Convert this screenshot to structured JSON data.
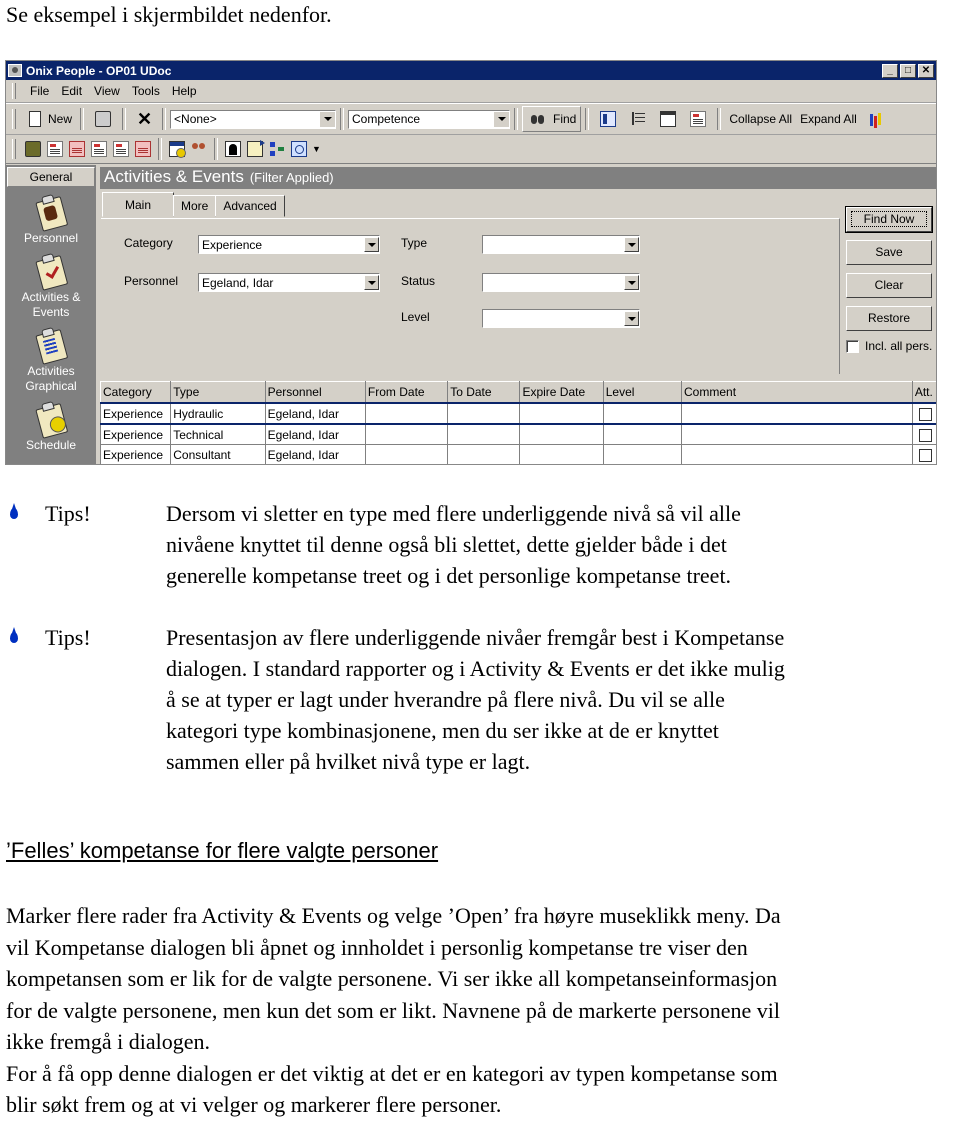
{
  "intro": "Se eksempel i skjermbildet nedenfor.",
  "window": {
    "title": "Onix People - OP01 UDoc",
    "controls": [
      "_",
      "□",
      "✕"
    ],
    "menu": [
      {
        "label": "File",
        "underline": "F"
      },
      {
        "label": "Edit",
        "underline": "E"
      },
      {
        "label": "View",
        "underline": "V"
      },
      {
        "label": "Tools",
        "underline": "T"
      },
      {
        "label": "Help",
        "underline": "H"
      }
    ],
    "toolbar": {
      "new_label": "New",
      "combo1_value": "<None>",
      "combo2_value": "Competence",
      "find_label": "Find",
      "collapse_all": "Collapse All",
      "expand_all": "Expand All"
    },
    "toolbar2_icons": [
      "folder-icon",
      "document-icon",
      "red-document-icon",
      "copy-document-icon",
      "delete-document-icon",
      "numbered-document-icon",
      "calendar-clock-icon",
      "people-icon",
      "person-silhouette-icon",
      "house-arrow-icon",
      "flow-arrow-icon",
      "circle-icon"
    ],
    "sidebar": {
      "header": "General",
      "items": [
        {
          "label": "Personnel",
          "icon": "personnel-clipboard-icon"
        },
        {
          "label": "Activities & Events",
          "icon": "activities-clipboard-icon"
        },
        {
          "label": "Activities Graphical",
          "icon": "graphical-clipboard-icon"
        },
        {
          "label": "Schedule",
          "icon": "schedule-clipboard-icon"
        }
      ]
    },
    "panel": {
      "title": "Activities & Events",
      "subtitle": "(Filter Applied)",
      "tabs": [
        "Main",
        "More",
        "Advanced"
      ],
      "active_tab": "Main",
      "fields": {
        "category": {
          "label": "Category",
          "value": "Experience"
        },
        "personnel": {
          "label": "Personnel",
          "value": "Egeland, Idar"
        },
        "type": {
          "label": "Type",
          "value": ""
        },
        "status": {
          "label": "Status",
          "value": ""
        },
        "level": {
          "label": "Level",
          "value": ""
        }
      },
      "buttons": {
        "find_now": "Find Now",
        "save": "Save",
        "clear": "Clear",
        "restore": "Restore"
      },
      "incl_all_pers": {
        "label": "Incl. all pers.",
        "checked": false
      }
    },
    "grid": {
      "columns": [
        "Category",
        "Type",
        "Personnel",
        "From Date",
        "To Date",
        "Expire Date",
        "Level",
        "Comment",
        "Att."
      ],
      "rows": [
        {
          "category": "Experience",
          "type": "Hydraulic",
          "personnel": "Egeland, Idar",
          "from": "",
          "to": "",
          "expire": "",
          "level": "",
          "comment": "",
          "att": false
        },
        {
          "category": "Experience",
          "type": "Technical",
          "personnel": "Egeland, Idar",
          "from": "",
          "to": "",
          "expire": "",
          "level": "",
          "comment": "",
          "att": false
        },
        {
          "category": "Experience",
          "type": "Consultant",
          "personnel": "Egeland, Idar",
          "from": "",
          "to": "",
          "expire": "",
          "level": "",
          "comment": "",
          "att": false
        }
      ]
    }
  },
  "tips": [
    {
      "label": "Tips!",
      "lines": [
        "Dersom vi sletter en type med flere underliggende nivå så vil alle",
        "nivåene knyttet til denne også bli slettet, dette gjelder både i det",
        "generelle kompetanse treet og i det personlige kompetanse treet."
      ]
    },
    {
      "label": "Tips!",
      "lines": [
        "Presentasjon av flere underliggende nivåer fremgår best i Kompetanse",
        "dialogen. I standard rapporter og i Activity & Events er det ikke mulig",
        "å se at typer  er lagt under hverandre på flere nivå. Du vil se alle",
        "kategori type kombinasjonene, men du ser ikke at de er knyttet",
        "sammen eller på hvilket nivå type er lagt."
      ]
    }
  ],
  "section_heading": "’Felles’ kompetanse for flere valgte personer",
  "paragraph_lines": [
    "Marker flere rader fra Activity & Events og velge ’Open’ fra høyre museklikk meny. Da",
    "vil Kompetanse dialogen bli åpnet og innholdet i personlig kompetanse tre viser den",
    "kompetansen som er lik for de valgte personene. Vi ser ikke all kompetanseinformasjon",
    "for de valgte personene, men kun det som er likt. Navnene på de markerte personene vil",
    "ikke fremgå i dialogen.",
    "For å få opp denne dialogen er det viktig at det er en kategori av typen kompetanse som",
    "blir søkt frem og at vi velger og markerer flere personer."
  ],
  "colors": {
    "titlebar": "#0a246a",
    "window_bg": "#d4d0c8",
    "sidebar_bg": "#808080",
    "bullet": "#0030c0"
  }
}
